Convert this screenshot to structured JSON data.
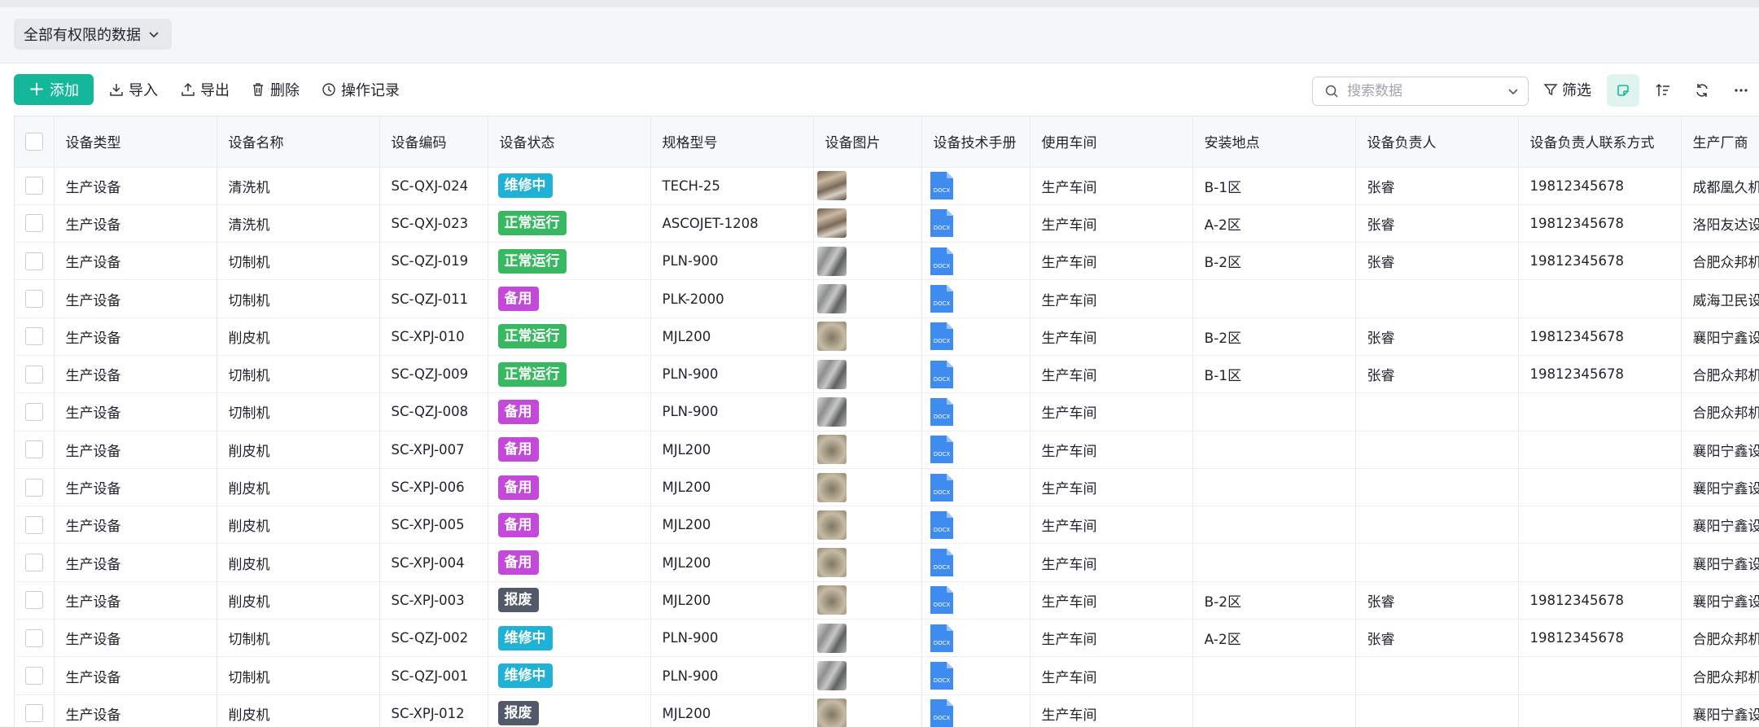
{
  "view": {
    "label": "全部有权限的数据"
  },
  "toolbar": {
    "add": "添加",
    "import": "导入",
    "export": "导出",
    "delete": "删除",
    "log": "操作记录",
    "search_placeholder": "搜索数据",
    "filter": "筛选"
  },
  "colors": {
    "accent": "#14b79a",
    "repair": "#1fb1d6",
    "running": "#37b861",
    "standby": "#c34ad8",
    "scrapped": "#525a69",
    "doc": "#3f8cf0"
  },
  "icons": [
    "chevron-down-icon",
    "plus-icon",
    "import-icon",
    "export-icon",
    "trash-icon",
    "history-icon",
    "search-icon",
    "filter-icon",
    "board-view-icon",
    "sort-icon",
    "refresh-icon",
    "more-icon",
    "docx-file-icon"
  ],
  "table": {
    "headers": [
      "设备类型",
      "设备名称",
      "设备编码",
      "设备状态",
      "规格型号",
      "设备图片",
      "设备技术手册",
      "使用车间",
      "安装地点",
      "设备负责人",
      "设备负责人联系方式",
      "生产厂商"
    ],
    "doc_label": "DOCX",
    "rows": [
      {
        "type": "生产设备",
        "name": "清洗机",
        "code": "SC-QXJ-024",
        "status": "维修中",
        "status_color": "#1fb1d6",
        "model": "TECH-25",
        "img": "a",
        "workshop": "生产车间",
        "location": "B-1区",
        "owner": "张睿",
        "phone": "19812345678",
        "maker": "成都凰久机"
      },
      {
        "type": "生产设备",
        "name": "清洗机",
        "code": "SC-QXJ-023",
        "status": "正常运行",
        "status_color": "#37b861",
        "model": "ASCOJET-1208",
        "img": "a",
        "workshop": "生产车间",
        "location": "A-2区",
        "owner": "张睿",
        "phone": "19812345678",
        "maker": "洛阳友达设"
      },
      {
        "type": "生产设备",
        "name": "切制机",
        "code": "SC-QZJ-019",
        "status": "正常运行",
        "status_color": "#37b861",
        "model": "PLN-900",
        "img": "b",
        "workshop": "生产车间",
        "location": "B-2区",
        "owner": "张睿",
        "phone": "19812345678",
        "maker": "合肥众邦机"
      },
      {
        "type": "生产设备",
        "name": "切制机",
        "code": "SC-QZJ-011",
        "status": "备用",
        "status_color": "#c34ad8",
        "model": "PLK-2000",
        "img": "b",
        "workshop": "生产车间",
        "location": "",
        "owner": "",
        "phone": "",
        "maker": "威海卫民设"
      },
      {
        "type": "生产设备",
        "name": "削皮机",
        "code": "SC-XPJ-010",
        "status": "正常运行",
        "status_color": "#37b861",
        "model": "MJL200",
        "img": "c",
        "workshop": "生产车间",
        "location": "B-2区",
        "owner": "张睿",
        "phone": "19812345678",
        "maker": "襄阳宁鑫设"
      },
      {
        "type": "生产设备",
        "name": "切制机",
        "code": "SC-QZJ-009",
        "status": "正常运行",
        "status_color": "#37b861",
        "model": "PLN-900",
        "img": "b",
        "workshop": "生产车间",
        "location": "B-1区",
        "owner": "张睿",
        "phone": "19812345678",
        "maker": "合肥众邦机"
      },
      {
        "type": "生产设备",
        "name": "切制机",
        "code": "SC-QZJ-008",
        "status": "备用",
        "status_color": "#c34ad8",
        "model": "PLN-900",
        "img": "b",
        "workshop": "生产车间",
        "location": "",
        "owner": "",
        "phone": "",
        "maker": "合肥众邦机"
      },
      {
        "type": "生产设备",
        "name": "削皮机",
        "code": "SC-XPJ-007",
        "status": "备用",
        "status_color": "#c34ad8",
        "model": "MJL200",
        "img": "c",
        "workshop": "生产车间",
        "location": "",
        "owner": "",
        "phone": "",
        "maker": "襄阳宁鑫设"
      },
      {
        "type": "生产设备",
        "name": "削皮机",
        "code": "SC-XPJ-006",
        "status": "备用",
        "status_color": "#c34ad8",
        "model": "MJL200",
        "img": "c",
        "workshop": "生产车间",
        "location": "",
        "owner": "",
        "phone": "",
        "maker": "襄阳宁鑫设"
      },
      {
        "type": "生产设备",
        "name": "削皮机",
        "code": "SC-XPJ-005",
        "status": "备用",
        "status_color": "#c34ad8",
        "model": "MJL200",
        "img": "c",
        "workshop": "生产车间",
        "location": "",
        "owner": "",
        "phone": "",
        "maker": "襄阳宁鑫设"
      },
      {
        "type": "生产设备",
        "name": "削皮机",
        "code": "SC-XPJ-004",
        "status": "备用",
        "status_color": "#c34ad8",
        "model": "MJL200",
        "img": "c",
        "workshop": "生产车间",
        "location": "",
        "owner": "",
        "phone": "",
        "maker": "襄阳宁鑫设"
      },
      {
        "type": "生产设备",
        "name": "削皮机",
        "code": "SC-XPJ-003",
        "status": "报废",
        "status_color": "#525a69",
        "model": "MJL200",
        "img": "c",
        "workshop": "生产车间",
        "location": "B-2区",
        "owner": "张睿",
        "phone": "19812345678",
        "maker": "襄阳宁鑫设"
      },
      {
        "type": "生产设备",
        "name": "切制机",
        "code": "SC-QZJ-002",
        "status": "维修中",
        "status_color": "#1fb1d6",
        "model": "PLN-900",
        "img": "b",
        "workshop": "生产车间",
        "location": "A-2区",
        "owner": "张睿",
        "phone": "19812345678",
        "maker": "合肥众邦机"
      },
      {
        "type": "生产设备",
        "name": "切制机",
        "code": "SC-QZJ-001",
        "status": "维修中",
        "status_color": "#1fb1d6",
        "model": "PLN-900",
        "img": "b",
        "workshop": "生产车间",
        "location": "",
        "owner": "",
        "phone": "",
        "maker": "合肥众邦机"
      },
      {
        "type": "生产设备",
        "name": "削皮机",
        "code": "SC-XPJ-012",
        "status": "报废",
        "status_color": "#525a69",
        "model": "MJL200",
        "img": "c",
        "workshop": "生产车间",
        "location": "",
        "owner": "",
        "phone": "",
        "maker": "襄阳宁鑫设"
      }
    ]
  }
}
